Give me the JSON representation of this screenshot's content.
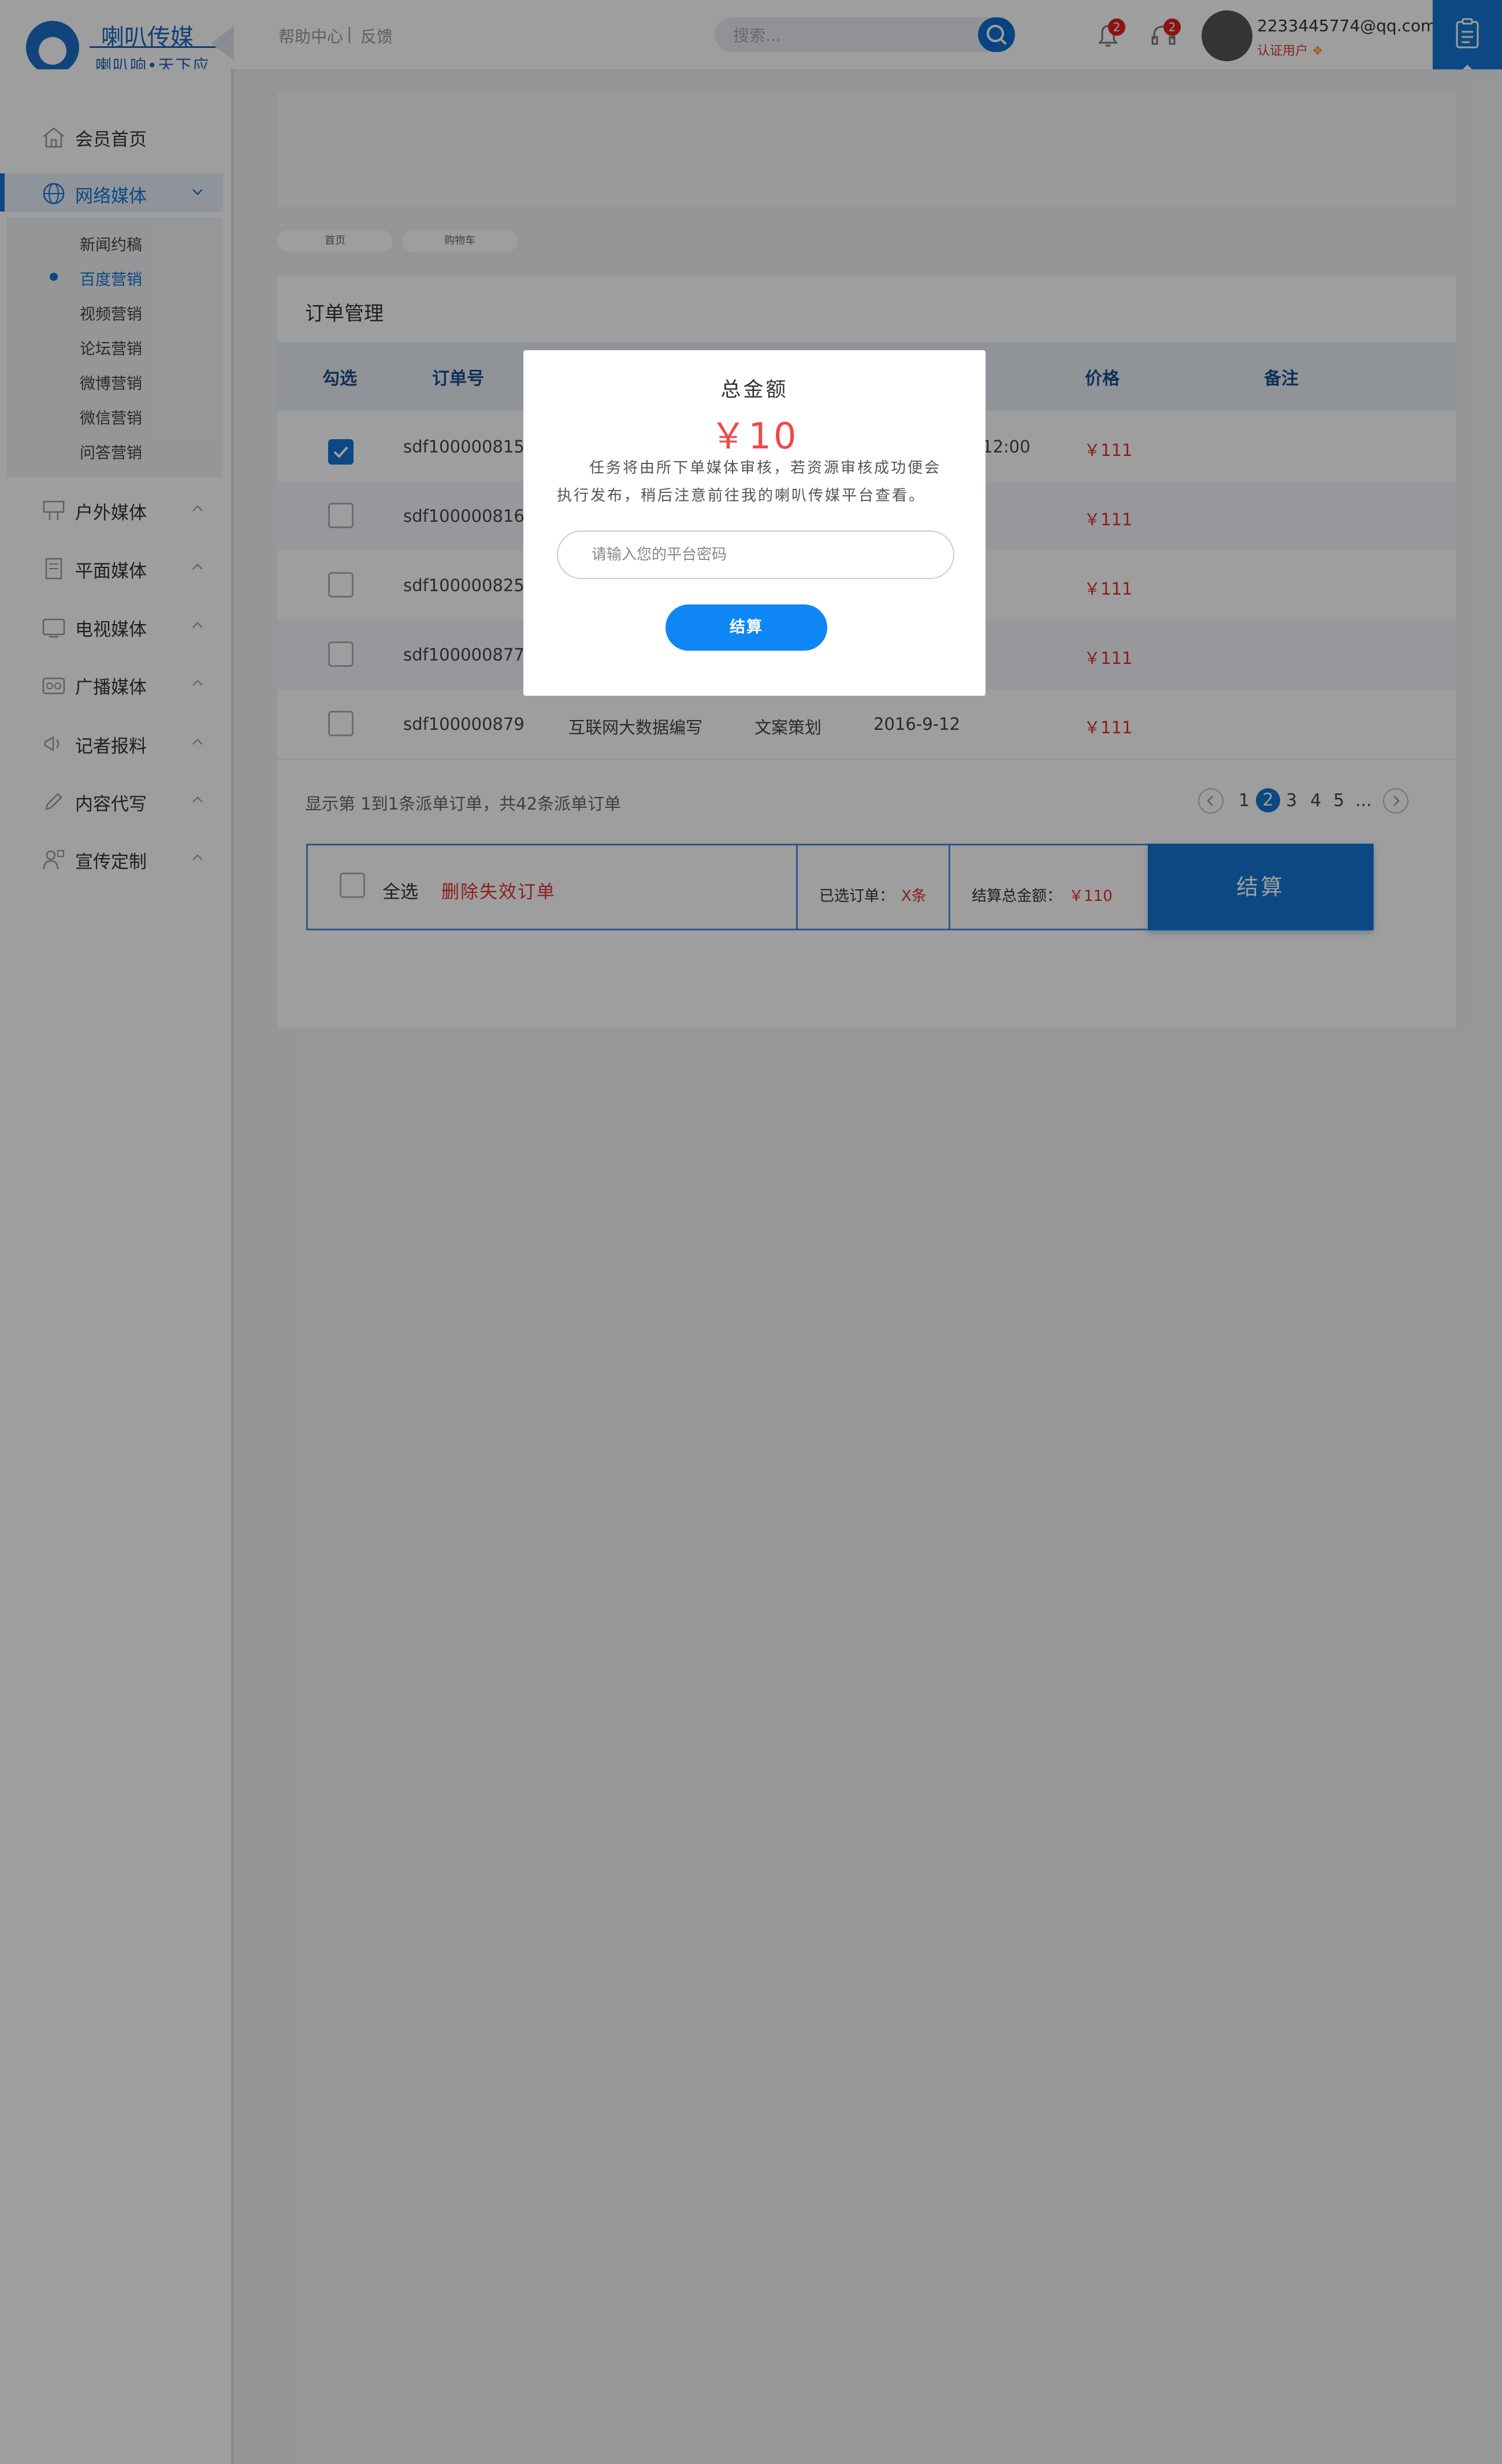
{
  "header": {
    "logo_title": "喇叭传媒",
    "logo_slogan": "喇叭响•天下应",
    "help_link": "帮助中心",
    "separator": "|",
    "feedback_link": "反馈",
    "search_placeholder": "搜索...",
    "notifications_badge": "2",
    "messages_badge": "2",
    "user_email": "2233445774@qq.com",
    "user_level": "认证用户"
  },
  "sidebar": {
    "items": [
      {
        "label": "会员首页",
        "icon": "home-icon"
      },
      {
        "label": "网络媒体",
        "icon": "globe-icon"
      },
      {
        "label": "户外媒体",
        "icon": "billboard-icon"
      },
      {
        "label": "平面媒体",
        "icon": "print-media-icon"
      },
      {
        "label": "电视媒体",
        "icon": "tv-icon"
      },
      {
        "label": "广播媒体",
        "icon": "radio-icon"
      },
      {
        "label": "记者报料",
        "icon": "reporter-icon"
      },
      {
        "label": "内容代写",
        "icon": "content-writing-icon"
      },
      {
        "label": "宣传定制",
        "icon": "custom-promo-icon"
      }
    ],
    "subitems": [
      "新闻约稿",
      "百度营销",
      "视频营销",
      "论坛营销",
      "微博营销",
      "微信营销",
      "问答营销"
    ],
    "active_subitem": "百度营销"
  },
  "breadcrumbs": [
    "首页",
    "购物车"
  ],
  "orders": {
    "title": "订单管理",
    "columns": {
      "check": "勾选",
      "order_no": "订单号",
      "price": "价格",
      "remark": "备注"
    },
    "rows": [
      {
        "checked": true,
        "order_no": "sdf100000815",
        "media": "",
        "type": "",
        "date": "12:00",
        "price": "￥111"
      },
      {
        "checked": false,
        "order_no": "sdf100000816",
        "media": "",
        "type": "",
        "date": "",
        "price": "￥111"
      },
      {
        "checked": false,
        "order_no": "sdf100000825",
        "media": "",
        "type": "",
        "date": "",
        "price": "￥111"
      },
      {
        "checked": false,
        "order_no": "sdf100000877",
        "media": "",
        "type": "",
        "date": "",
        "price": "￥111"
      },
      {
        "checked": false,
        "order_no": "sdf100000879",
        "media": "互联网大数据编写",
        "type": "文案策划",
        "date": "2016-9-12",
        "price": "￥111"
      }
    ],
    "summary": "显示第 1到1条派单订单，共42条派单订单",
    "pagination": {
      "pages": [
        "1",
        "2",
        "3",
        "4",
        "5",
        "..."
      ],
      "current": "2"
    }
  },
  "checkout_bar": {
    "select_all": "全选",
    "delete_invalid": "删除失效订单",
    "selected_label": "已选订单：",
    "selected_value": "X条",
    "total_label": "结算总金额：",
    "total_value": "￥110",
    "checkout": "结算"
  },
  "modal": {
    "title": "总金额",
    "amount": "￥10",
    "text": "任务将由所下单媒体审核，若资源审核成功便会执行发布，稍后注意前往我的喇叭传媒平台查看。",
    "password_placeholder": "请输入您的平台密码",
    "confirm": "结算"
  },
  "colors": {
    "accent": "#1474d4",
    "price_red": "#e03131",
    "modal_button": "#0f86f5"
  }
}
